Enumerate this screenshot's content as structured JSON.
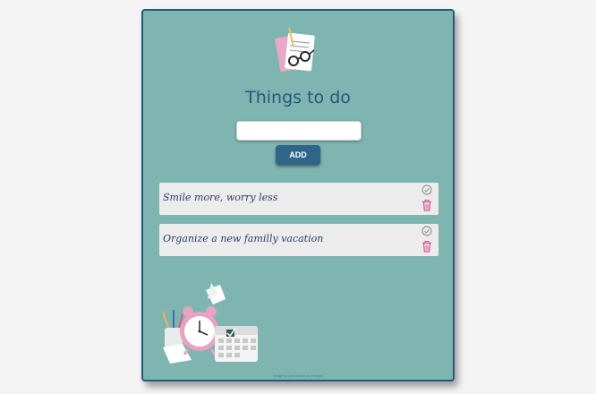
{
  "app": {
    "title": "Things to do",
    "hero_icon": "papers-glasses-icon",
    "footer_icon": "alarm-clock-calendar-icon"
  },
  "form": {
    "input_value": "",
    "input_placeholder": "",
    "add_label": "ADD"
  },
  "todos": [
    {
      "text": "Smile more, worry less",
      "done_icon": "check-circle-icon",
      "delete_icon": "trash-icon"
    },
    {
      "text": "Organize a new familly vacation",
      "done_icon": "check-circle-icon",
      "delete_icon": "trash-icon"
    }
  ],
  "footer": {
    "credit": "Image by pch.vector on Freepik"
  },
  "colors": {
    "card_bg": "#7fb5b1",
    "card_border": "#24597a",
    "accent": "#2f6688",
    "item_bg": "#ececec",
    "trash": "#d64f8a"
  }
}
